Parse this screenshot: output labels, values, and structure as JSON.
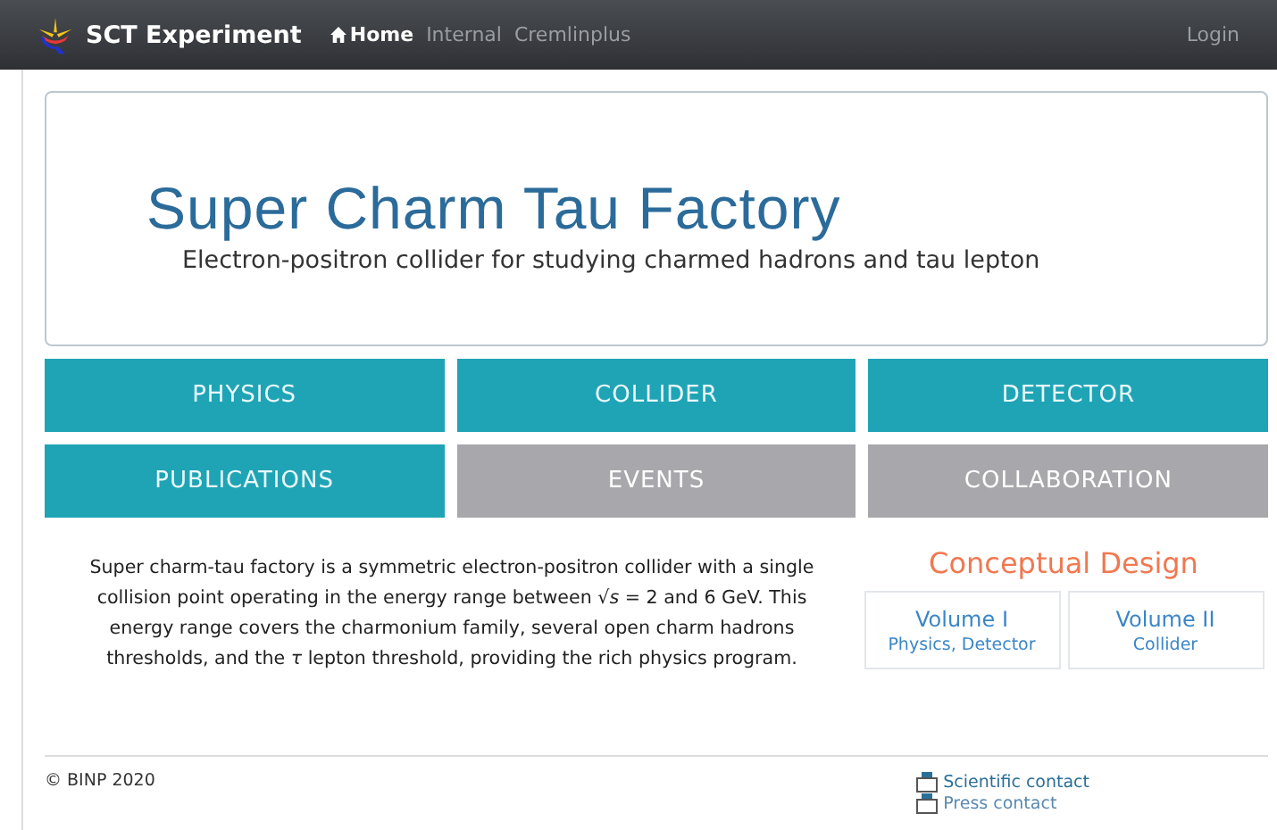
{
  "navbar": {
    "brand": "SCT Experiment",
    "links": [
      {
        "label": "Home",
        "selected": true
      },
      {
        "label": "Internal",
        "selected": false
      },
      {
        "label": "Cremlinplus",
        "selected": false
      }
    ],
    "login": "Login"
  },
  "hero": {
    "title": "Super Charm Tau Factory",
    "subtitle": "Electron-positron collider for studying charmed hadrons and tau lepton"
  },
  "tiles": [
    {
      "label": "PHYSICS",
      "disabled": false
    },
    {
      "label": "COLLIDER",
      "disabled": false
    },
    {
      "label": "DETECTOR",
      "disabled": false
    },
    {
      "label": "PUBLICATIONS",
      "disabled": false
    },
    {
      "label": "EVENTS",
      "disabled": true
    },
    {
      "label": "COLLABORATION",
      "disabled": true
    }
  ],
  "description": "Super charm-tau factory is a symmetric electron-positron collider with a single collision point operating in the energy range between √*s* = 2 and 6 GeV. This energy range covers the charmonium family, several open charm hadrons thresholds, and the *τ* lepton threshold, providing the rich physics program.",
  "conceptual_design": {
    "title": "Conceptual Design",
    "volumes": [
      {
        "title": "Volume I",
        "subtitle": "Physics, Detector"
      },
      {
        "title": "Volume II",
        "subtitle": "Collider"
      }
    ]
  },
  "footer": {
    "copyright": "© BINP 2020",
    "contacts": [
      "Scientific contact",
      "Press contact"
    ]
  }
}
